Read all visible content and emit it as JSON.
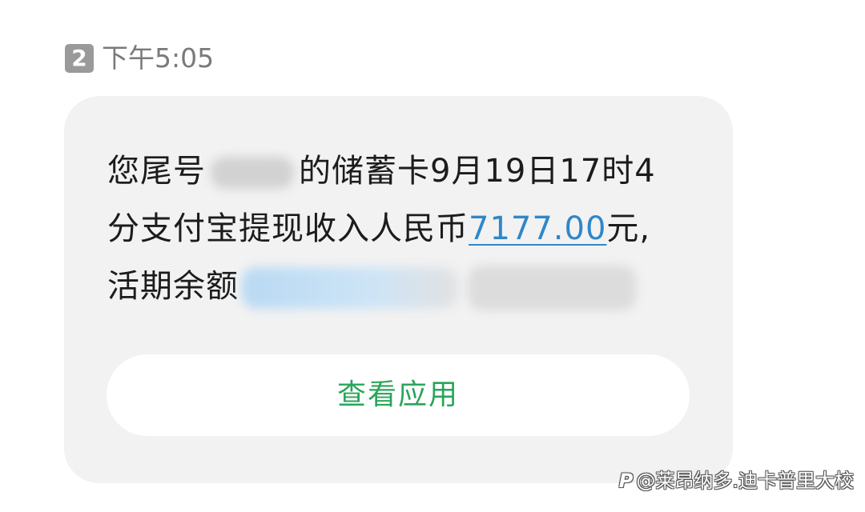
{
  "header": {
    "sim_slot": "2",
    "time": "下午5:05"
  },
  "message": {
    "line1_prefix": "您尾号",
    "line1_suffix": "的储蓄卡9月19日17时4",
    "line2_prefix": "分支付宝提现收入人民币",
    "amount": "7177.00",
    "line2_suffix": "元,",
    "line3_prefix": "活期余额"
  },
  "action": {
    "view_app_label": "查看应用"
  },
  "watermark": {
    "logo": "P",
    "text": "@莱昂纳多.迪卡普里大校"
  },
  "colors": {
    "accent_green": "#2aa55b",
    "link_blue": "#2f87c9",
    "bubble_bg": "#f2f2f2"
  }
}
